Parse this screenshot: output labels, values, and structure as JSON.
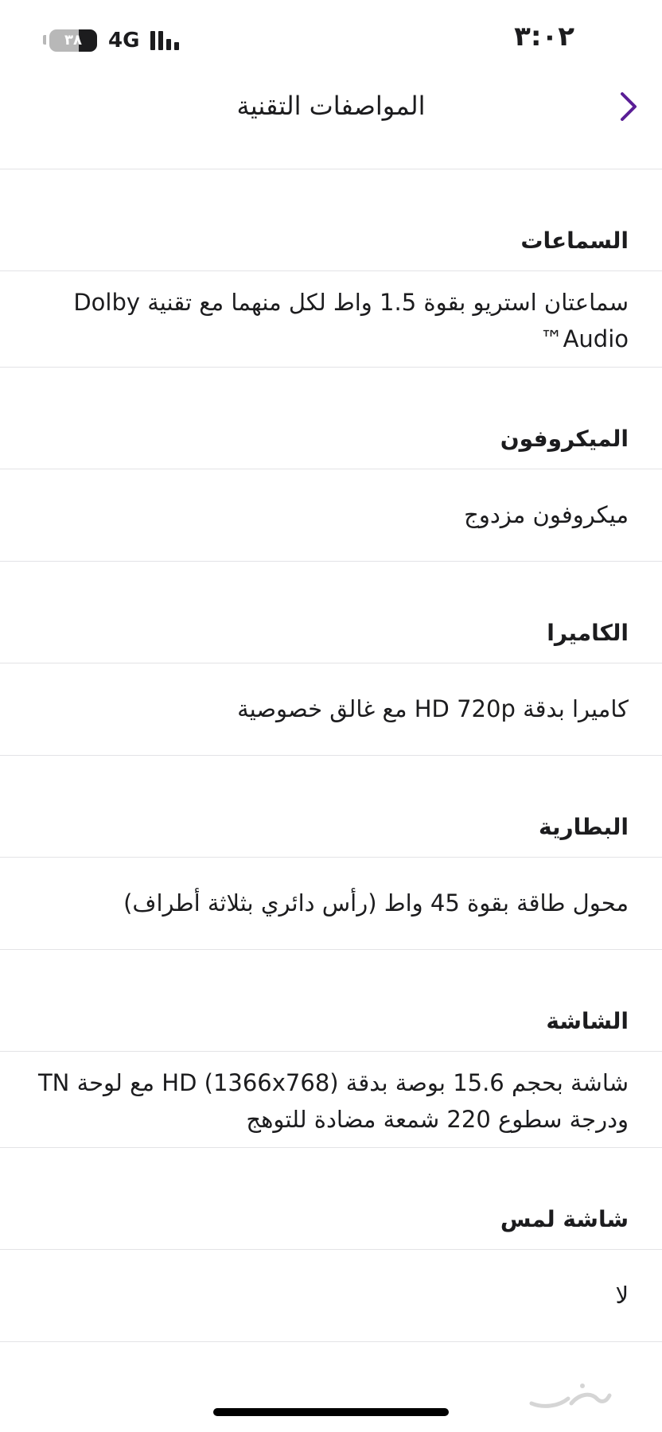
{
  "status_bar": {
    "time": "٣:٠٢",
    "network": "4G",
    "battery_level": "٣٨",
    "battery_fraction": 0.38,
    "icons": [
      "battery-icon",
      "signal-bars-icon"
    ]
  },
  "header": {
    "title": "المواصفات التقنية",
    "back_icon": "chevron-right-icon",
    "accent_color": "#5a1e96"
  },
  "specs": [
    {
      "heading": "السماعات",
      "value": "سماعتان استريو بقوة 1.5 واط لكل منهما مع تقنية Dolby Audio™"
    },
    {
      "heading": "الميكروفون",
      "value": "ميكروفون مزدوج"
    },
    {
      "heading": "الكاميرا",
      "value": "كاميرا بدقة HD 720p مع غالق خصوصية"
    },
    {
      "heading": "البطارية",
      "value": "محول طاقة بقوة 45 واط (رأس دائري بثلاثة أطراف)"
    },
    {
      "heading": "الشاشة",
      "value": "شاشة بحجم 15.6 بوصة بدقة HD (1366x768) مع لوحة TN ودرجة سطوع 220 شمعة مضادة للتوهج"
    },
    {
      "heading": "شاشة لمس",
      "value": "لا"
    }
  ],
  "watermark": {
    "text": "حراج",
    "icon": "haraj-logo-watermark"
  }
}
